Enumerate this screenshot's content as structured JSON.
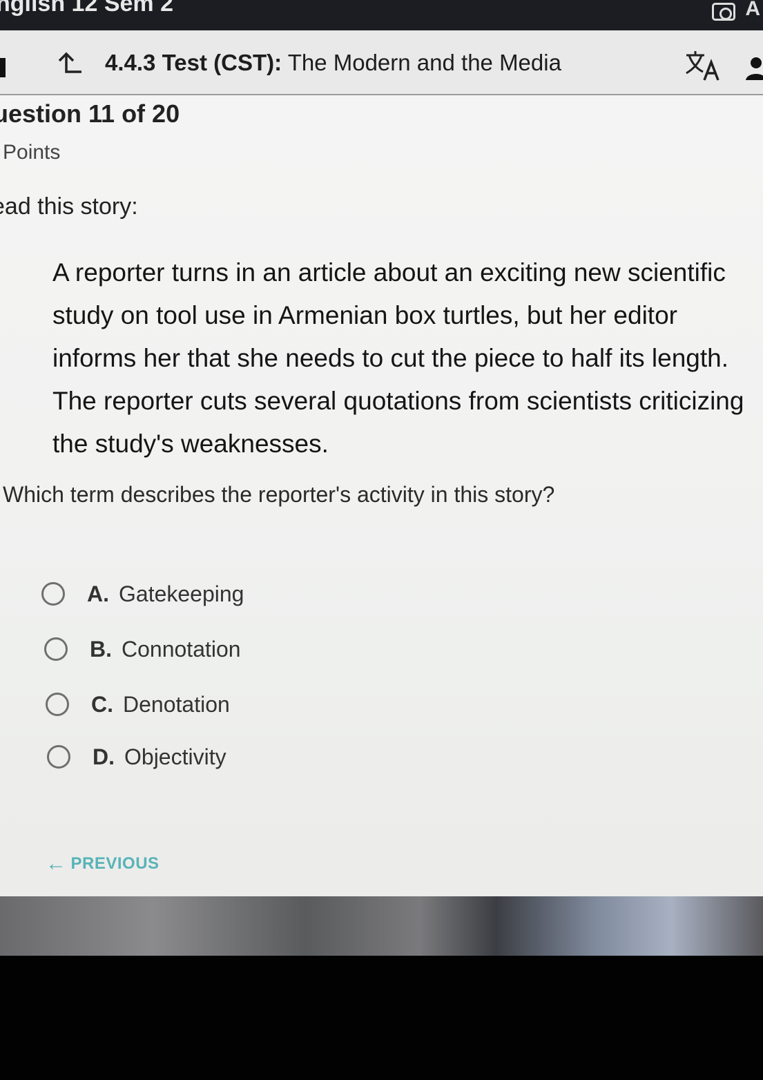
{
  "top_bar": {
    "course_title": "nglish 12 Sem 2",
    "right_letter": "A"
  },
  "header": {
    "activity_code": "4.4.3",
    "activity_type": "Test (CST):",
    "activity_title": "The Modern and the Media"
  },
  "question_meta": {
    "number_text": "uestion 11 of 20",
    "points_text": "Points"
  },
  "prompt": "ead this story:",
  "story": "A reporter turns in an article about an exciting new scientific study on tool use in Armenian box turtles, but her editor informs her that she needs to cut the piece to half its length. The reporter cuts several quotations from scientists criticizing the study's weaknesses.",
  "question": "Which term describes the reporter's activity in this story?",
  "choices": [
    {
      "letter": "A.",
      "text": "Gatekeeping"
    },
    {
      "letter": "B.",
      "text": "Connotation"
    },
    {
      "letter": "C.",
      "text": "Denotation"
    },
    {
      "letter": "D.",
      "text": "Objectivity"
    }
  ],
  "navigation": {
    "previous_label": "PREVIOUS"
  },
  "colors": {
    "previous_accent": "#58b3b8",
    "top_bar_bg": "#1b1d22"
  },
  "icons": {
    "up": "up-arrow-icon",
    "translate": "translate-icon",
    "camera": "camera-icon",
    "user": "user-icon"
  }
}
